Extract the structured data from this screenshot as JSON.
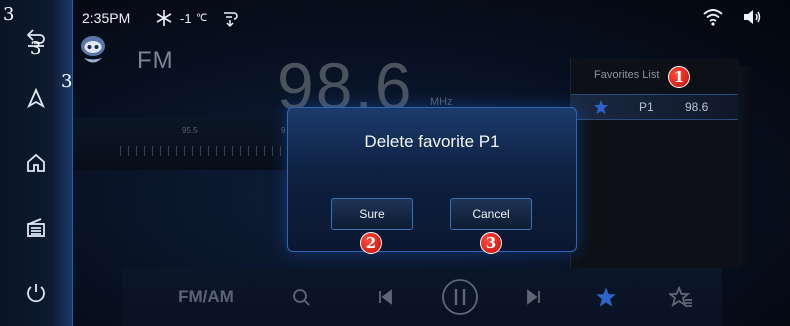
{
  "sidebar": {
    "corner_number": "3",
    "back_number": "3",
    "nav_number": "3",
    "items": [
      {
        "icon": "back-icon"
      },
      {
        "icon": "navigation-icon"
      },
      {
        "icon": "home-icon"
      },
      {
        "icon": "radio-icon"
      },
      {
        "icon": "power-icon"
      }
    ]
  },
  "status_bar": {
    "time": "2:35PM",
    "temperature": "-1",
    "temp_unit": "℃",
    "icons": [
      "snowflake-icon",
      "fan-icon",
      "wifi-icon",
      "volume-icon"
    ]
  },
  "radio": {
    "band": "FM",
    "frequency": "98.6",
    "unit": "MHz",
    "scale_labels": [
      "95.5",
      "9"
    ]
  },
  "favorites": {
    "title": "Favorites List",
    "badge": "1",
    "items": [
      {
        "preset": "P1",
        "frequency": "98.6"
      }
    ]
  },
  "dialog": {
    "title": "Delete favorite P1",
    "confirm_label": "Sure",
    "cancel_label": "Cancel",
    "confirm_badge": "2",
    "cancel_badge": "3"
  },
  "bottom_bar": {
    "band_toggle_label": "FM/AM",
    "icons": [
      "search-icon",
      "previous-icon",
      "pause-icon",
      "next-icon",
      "favorite-star-icon",
      "favorites-list-icon"
    ]
  },
  "colors": {
    "accent": "#2f67b8",
    "badge_red": "#d9140e",
    "star_blue": "#2e64c9"
  }
}
